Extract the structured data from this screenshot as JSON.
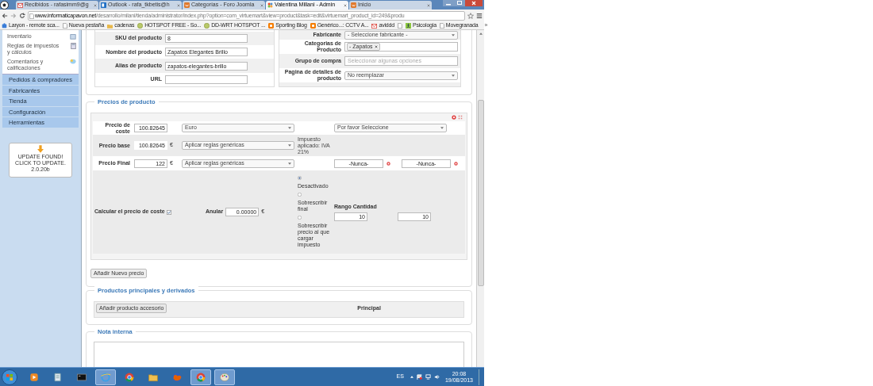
{
  "browser": {
    "tabs": [
      {
        "kind": "mail",
        "title": "Recibidos - rafasimm9@g",
        "selected": false
      },
      {
        "kind": "tile",
        "title": "Outlook - rafa_tkbetis@h",
        "selected": false
      },
      {
        "kind": "forum",
        "title": "Categorías - Foro Joomla",
        "selected": false
      },
      {
        "kind": "flower",
        "title": "Valentina Millani - Admin",
        "selected": true
      },
      {
        "kind": "forum",
        "title": "Inicio",
        "selected": false
      }
    ],
    "url_host": "www.informaticapavon.net",
    "url_path": "/desarrollo/milani/tienda/administrator/index.php?option=com_virtuemart&view=product&task=edit&virtuemart_product_id=249&produ",
    "bookmarks": [
      {
        "kind": "app",
        "label": "Laryon - remote sca..."
      },
      {
        "kind": "page",
        "label": "Nueva pestaña"
      },
      {
        "kind": "folder",
        "label": "cadenas"
      },
      {
        "kind": "globe",
        "label": "HOTSPOT FREE - So..."
      },
      {
        "kind": "globe",
        "label": "DD-WRT HOTSPOT ..."
      },
      {
        "kind": "blog",
        "label": "Sporting Blog"
      },
      {
        "kind": "blog",
        "label": "Genérico...: CCTV A..."
      },
      {
        "kind": "mail",
        "label": "aviddd"
      },
      {
        "kind": "page"
      },
      {
        "kind": "figure",
        "label": "Psicologia"
      },
      {
        "kind": "page",
        "label": "Movegranada"
      }
    ],
    "bookmarks_more": "»"
  },
  "sidebar": {
    "items": [
      {
        "kind": "inventory",
        "label": "Inventario"
      },
      {
        "kind": "tax",
        "label": "Reglas de impuestos y cálculos"
      },
      {
        "kind": "comments",
        "label": "Comentarios y calificaciones"
      }
    ],
    "menu": [
      "Pedidos & compradores",
      "Fabricantes",
      "Tienda",
      "Configuración",
      "Herramientas"
    ],
    "update": {
      "text": "UPDATE FOUND! CLICK TO UPDATE.",
      "version": "2.0.20b"
    }
  },
  "product_fields": [
    {
      "label": "SKU del producto",
      "value": "8"
    },
    {
      "label": "Nombre del producto",
      "value": "Zapatos Elegantes Brillo"
    },
    {
      "label": "Alias de producto",
      "value": "zapatos-elegantes-brillo"
    },
    {
      "label": "URL"
    }
  ],
  "product_options": [
    {
      "kind": "select",
      "label": "Fabricante",
      "value": "- Seleccione fabricante -"
    },
    {
      "kind": "tags",
      "label": "Categorias de Producto",
      "tags": [
        "- Zapatos"
      ]
    },
    {
      "kind": "multiselect",
      "label": "Grupo de compra",
      "placeholder": "Seleccionar algunas opciones"
    },
    {
      "kind": "select",
      "label": "Pagina de detalles de producto",
      "value": "No reemplazar"
    }
  ],
  "prices": {
    "title": "Precios de producto",
    "cost": {
      "label": "Precio de coste",
      "value": "100.82645",
      "currency": "Euro",
      "shopper_group": "Por favor Seleccione"
    },
    "base": {
      "label": "Precio base",
      "value": "100.82645",
      "unit": "€",
      "rule": "Aplicar reglas genéricas",
      "tax_note": "Impuesto aplicado: IVA 21%"
    },
    "final": {
      "label": "Precio Final",
      "value": "122",
      "unit": "€",
      "rule": "Aplicar reglas genéricas",
      "start_date": "-Nunca-",
      "end_date": "-Nunca-"
    },
    "calc": {
      "label": "Calcular el precio de coste",
      "checked": true,
      "override_label": "Anular",
      "override_value": "0.00000",
      "unit": "€",
      "options": [
        {
          "label": "Desactivado",
          "selected": true
        },
        {
          "label": "Sobrescribir final",
          "selected": false
        },
        {
          "label": "Sobrescribir precio al que cargar impuesto",
          "selected": false
        }
      ],
      "range_label": "Rango Cantidad",
      "range_from": "10",
      "range_to": "10"
    },
    "add_button": "Añadir Nuevo precio"
  },
  "related": {
    "title": "Productos principales y derivados",
    "button": "Añadir producto accesorio",
    "column": "Principal"
  },
  "note": {
    "title": "Nota interna"
  },
  "taskbar": {
    "apps": [
      {
        "kind": "media",
        "open": false
      },
      {
        "kind": "document",
        "open": false
      },
      {
        "kind": "terminal",
        "open": false
      },
      {
        "kind": "ie",
        "open": true
      },
      {
        "kind": "chrome",
        "open": false
      },
      {
        "kind": "folder",
        "open": false
      },
      {
        "kind": "firefox",
        "open": false
      },
      {
        "kind": "chrome",
        "open": true
      },
      {
        "kind": "paint",
        "open": true
      }
    ],
    "language": "ES",
    "time": "20:08",
    "date": "19/08/2013"
  }
}
